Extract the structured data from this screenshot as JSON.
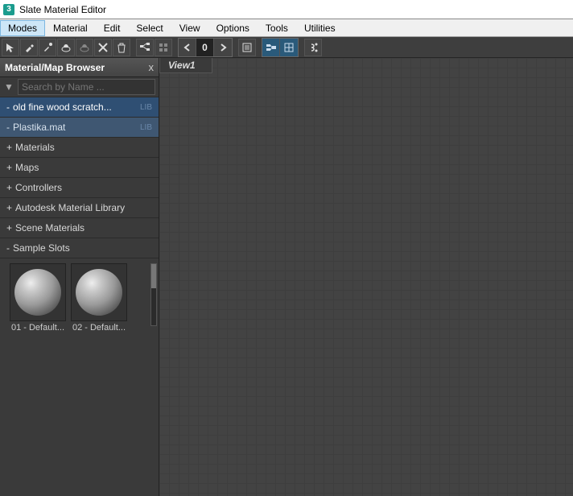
{
  "window": {
    "title": "Slate Material Editor"
  },
  "menu": {
    "items": [
      "Modes",
      "Material",
      "Edit",
      "Select",
      "View",
      "Options",
      "Tools",
      "Utilities"
    ],
    "active_index": 0
  },
  "toolbar": {
    "icons": [
      "cursor",
      "picker",
      "eyedrop",
      "teapot",
      "teapot2",
      "cross",
      "trash",
      "sep",
      "nodes",
      "grid",
      "sep",
      "arrow-left",
      "zero",
      "arrow-right",
      "sep",
      "page",
      "sep",
      "layout1",
      "layout2",
      "sep",
      "link"
    ]
  },
  "browser": {
    "title": "Material/Map Browser",
    "close_label": "x",
    "search_placeholder": "Search by Name ...",
    "libs": [
      {
        "expand": "-",
        "label": "old fine wood scratch...",
        "tag": "LIB"
      },
      {
        "expand": "-",
        "label": "Plastika.mat",
        "tag": "LIB"
      }
    ],
    "categories": [
      {
        "expand": "+",
        "label": "Materials"
      },
      {
        "expand": "+",
        "label": "Maps"
      },
      {
        "expand": "+",
        "label": "Controllers"
      },
      {
        "expand": "+",
        "label": "Autodesk Material Library"
      },
      {
        "expand": "+",
        "label": "Scene Materials"
      }
    ],
    "sample_header": {
      "expand": "-",
      "label": "Sample Slots"
    },
    "slots": [
      {
        "label": "01 - Default..."
      },
      {
        "label": "02 - Default..."
      }
    ]
  },
  "view": {
    "tab_label": "View1"
  }
}
